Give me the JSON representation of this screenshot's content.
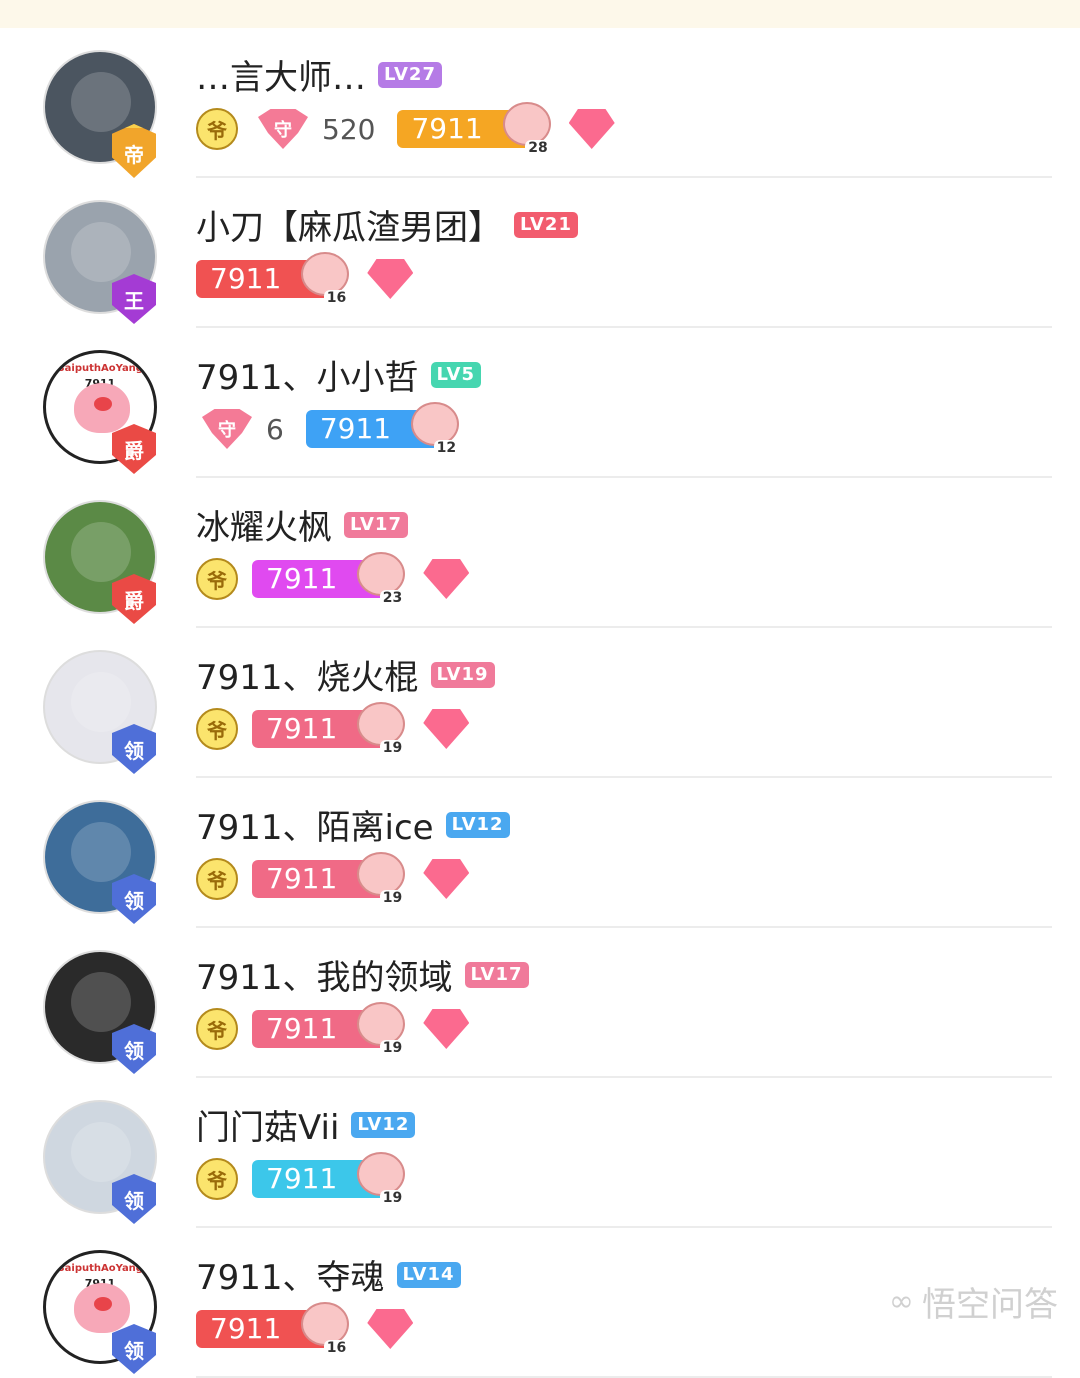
{
  "colors": {
    "lv_purple": "#b57be6",
    "lv_red": "#f25c6e",
    "lv_teal": "#46d6b0",
    "lv_pink": "#f07a9a",
    "lv_blue": "#4aa8f0",
    "fan_orange": "#f5a623",
    "fan_red": "#f05252",
    "fan_blue": "#3ea2f5",
    "fan_magenta": "#e04af0",
    "fan_pink": "#f06a86",
    "fan_cyan": "#3cc7ea"
  },
  "users": [
    {
      "name": "…言大师…",
      "level": "LV27",
      "lv_color": "#b57be6",
      "rank": "帝",
      "rank_type": "di",
      "yellow_icon": true,
      "guard": true,
      "guard_count": "520",
      "fan_label": "7911",
      "fan_color": "#f5a623",
      "fan_level": "28",
      "diamond": true,
      "avatar_color": "#4b5560",
      "logo": false
    },
    {
      "name": "小刀【麻瓜渣男团】",
      "level": "LV21",
      "lv_color": "#f25c6e",
      "rank": "王",
      "rank_type": "wang",
      "yellow_icon": false,
      "guard": false,
      "guard_count": "",
      "fan_label": "7911",
      "fan_color": "#f05252",
      "fan_level": "16",
      "diamond": true,
      "avatar_color": "#9aa3ad",
      "logo": false
    },
    {
      "name": "7911、小小哲",
      "level": "LV5",
      "lv_color": "#46d6b0",
      "rank": "爵",
      "rank_type": "jue",
      "yellow_icon": false,
      "guard": true,
      "guard_count": "6",
      "fan_label": "7911",
      "fan_color": "#3ea2f5",
      "fan_level": "12",
      "diamond": false,
      "avatar_color": "#ffffff",
      "logo": true
    },
    {
      "name": "冰耀火枫",
      "level": "LV17",
      "lv_color": "#f07a9a",
      "rank": "爵",
      "rank_type": "jue",
      "yellow_icon": true,
      "guard": false,
      "guard_count": "",
      "fan_label": "7911",
      "fan_color": "#e04af0",
      "fan_level": "23",
      "diamond": true,
      "avatar_color": "#5b8a46",
      "logo": false
    },
    {
      "name": "7911、烧火棍",
      "level": "LV19",
      "lv_color": "#f07a9a",
      "rank": "领",
      "rank_type": "ling",
      "yellow_icon": true,
      "guard": false,
      "guard_count": "",
      "fan_label": "7911",
      "fan_color": "#f06a86",
      "fan_level": "19",
      "diamond": true,
      "avatar_color": "#e6e6ec",
      "logo": false
    },
    {
      "name": "7911、陌离ice",
      "level": "LV12",
      "lv_color": "#4aa8f0",
      "rank": "领",
      "rank_type": "ling",
      "yellow_icon": true,
      "guard": false,
      "guard_count": "",
      "fan_label": "7911",
      "fan_color": "#f06a86",
      "fan_level": "19",
      "diamond": true,
      "avatar_color": "#3e6d9a",
      "logo": false
    },
    {
      "name": "7911、我的领域",
      "level": "LV17",
      "lv_color": "#f07a9a",
      "rank": "领",
      "rank_type": "ling",
      "yellow_icon": true,
      "guard": false,
      "guard_count": "",
      "fan_label": "7911",
      "fan_color": "#f06a86",
      "fan_level": "19",
      "diamond": true,
      "avatar_color": "#2a2a2a",
      "logo": false
    },
    {
      "name": "门门菇Vii",
      "level": "LV12",
      "lv_color": "#4aa8f0",
      "rank": "领",
      "rank_type": "ling",
      "yellow_icon": true,
      "guard": false,
      "guard_count": "",
      "fan_label": "7911",
      "fan_color": "#3cc7ea",
      "fan_level": "19",
      "diamond": false,
      "avatar_color": "#cfd7e0",
      "logo": false
    },
    {
      "name": "7911、夺魂",
      "level": "LV14",
      "lv_color": "#4aa8f0",
      "rank": "领",
      "rank_type": "ling",
      "yellow_icon": false,
      "guard": false,
      "guard_count": "",
      "fan_label": "7911",
      "fan_color": "#f05252",
      "fan_level": "16",
      "diamond": true,
      "avatar_color": "#ffffff",
      "logo": true
    }
  ],
  "logo_avatar": {
    "ring_text": "BaiputhAoYang",
    "number": "7911"
  },
  "watermark": {
    "icon": "∞",
    "text": "悟空问答"
  }
}
